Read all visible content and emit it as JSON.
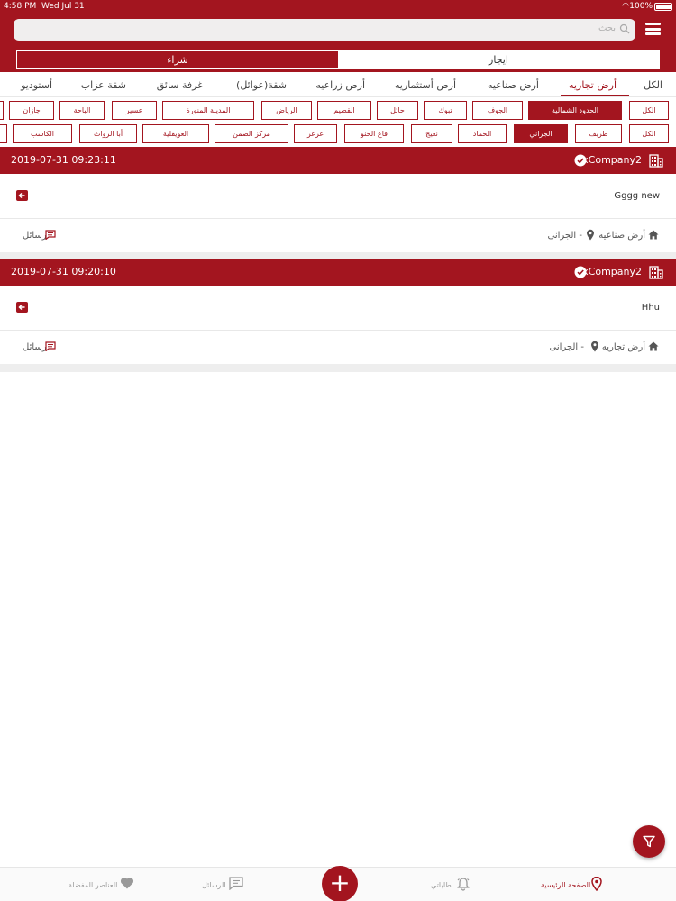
{
  "status_bar": {
    "time": "4:58 PM",
    "date": "Wed Jul 31",
    "battery": "100%"
  },
  "search": {
    "placeholder": "بحث"
  },
  "segment": {
    "buy": "شراء",
    "rent": "ايجار",
    "selected": "buy"
  },
  "category_tabs": [
    {
      "label": "الكل",
      "active": false
    },
    {
      "label": "أرض تجاريه",
      "active": true
    },
    {
      "label": "أرض صناعيه",
      "active": false
    },
    {
      "label": "أرض أستثماريه",
      "active": false
    },
    {
      "label": "أرض زراعيه",
      "active": false
    },
    {
      "label": "شقة(عوائل)",
      "active": false
    },
    {
      "label": "غرفة سائق",
      "active": false
    },
    {
      "label": "شقة عزاب",
      "active": false
    },
    {
      "label": "أستوديو",
      "active": false
    }
  ],
  "region_chips": [
    {
      "label": "الكل",
      "active": false
    },
    {
      "label": "الحدود الشمالية",
      "active": true
    },
    {
      "label": "الجوف",
      "active": false
    },
    {
      "label": "تبوك",
      "active": false
    },
    {
      "label": "حائل",
      "active": false
    },
    {
      "label": "القصيم",
      "active": false
    },
    {
      "label": "الرياض",
      "active": false
    },
    {
      "label": "المدينة المنورة",
      "active": false
    },
    {
      "label": "عسير",
      "active": false
    },
    {
      "label": "الباحة",
      "active": false
    },
    {
      "label": "جازان",
      "active": false
    }
  ],
  "city_chips": [
    {
      "label": "الكل",
      "active": false
    },
    {
      "label": "طريف",
      "active": false
    },
    {
      "label": "الجراني",
      "active": true
    },
    {
      "label": "الحماد",
      "active": false
    },
    {
      "label": "نعيج",
      "active": false
    },
    {
      "label": "قاع الحنو",
      "active": false
    },
    {
      "label": "عرعر",
      "active": false
    },
    {
      "label": "مركز الصمن",
      "active": false
    },
    {
      "label": "العويقلية",
      "active": false
    },
    {
      "label": "أبا الرواث",
      "active": false
    },
    {
      "label": "الكاسب",
      "active": false
    }
  ],
  "listings": [
    {
      "datetime": "2019-07-31 09:23:11",
      "company": "xCompany2",
      "title": "Gggg new",
      "type": "أرض صناعيه",
      "location": "الجرانى -",
      "messages_label": "رسائل"
    },
    {
      "datetime": "2019-07-31 09:20:10",
      "company": "xCompany2",
      "title": "Hhu",
      "type": "أرض تجاريه",
      "location": "الجرانى -",
      "messages_label": "رسائل"
    }
  ],
  "bottom_nav": {
    "home": "الصفحة الرئيسية",
    "requests": "طلباتي",
    "messages": "الرسائل",
    "favorites": "العناصر المفضلة"
  },
  "accent_color": "#a3151f"
}
